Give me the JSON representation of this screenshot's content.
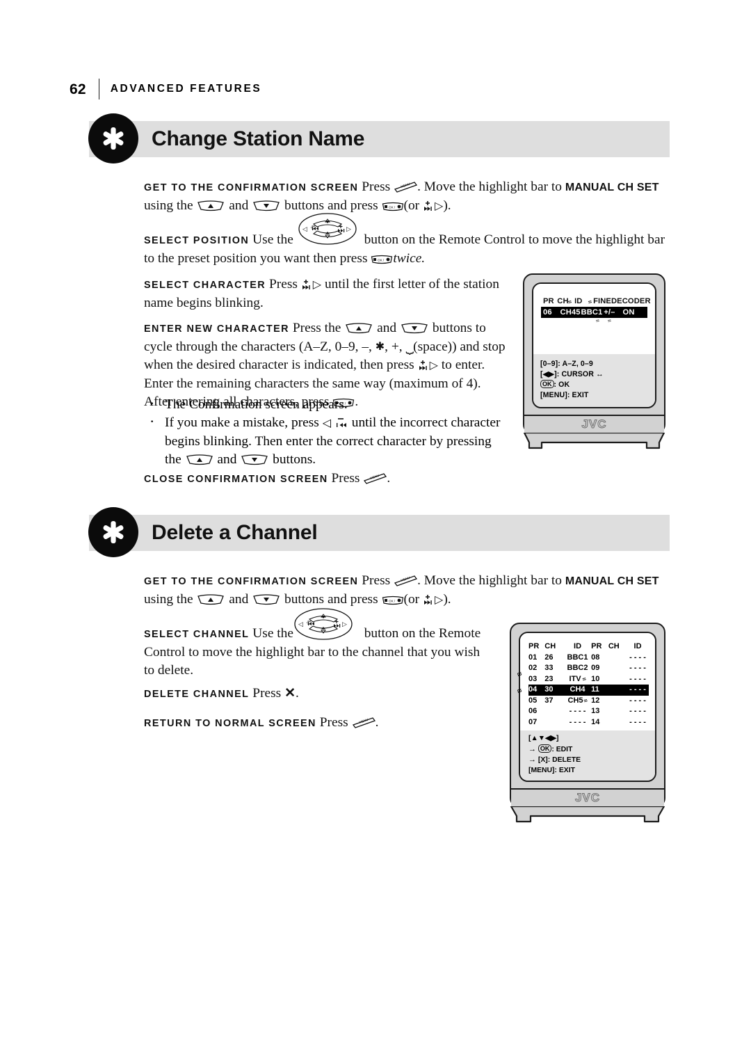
{
  "page": {
    "number": "62",
    "running_head": "ADVANCED FEATURES"
  },
  "sections": [
    {
      "id": "change-station-name",
      "title": "Change Station Name",
      "icon": "asterisk-star-icon",
      "steps": [
        {
          "label": "GET TO THE CONFIRMATION SCREEN",
          "text_1": "Press",
          "icon_1": "menu-button-icon",
          "text_2": ". Move the highlight bar to",
          "emphasis": "MANUAL CH SET",
          "text_3": "using the",
          "icon_2": "channel-up-button-icon",
          "text_4": "and",
          "icon_3": "channel-down-button-icon",
          "text_5": "buttons and press",
          "icon_4": "ok-button-icon",
          "text_6": "(or",
          "icon_5": "forward-plus-button-icon",
          "icon_6": "right-triangle-icon",
          "text_7": ")."
        },
        {
          "label": "SELECT POSITION",
          "text_1": "Use the",
          "icon_1": "four-way-pad-icon",
          "text_2": "button on the Remote Control to move the highlight bar to the preset position you want then press",
          "icon_2": "ok-button-icon",
          "text_3": "twice."
        },
        {
          "label": "SELECT CHARACTER",
          "text_1": "Press",
          "icon_1": "forward-plus-button-icon",
          "icon_2": "right-triangle-icon",
          "text_2": "until the first letter of the station name begins blinking."
        },
        {
          "label": "ENTER NEW CHARACTER",
          "text_1": "Press the",
          "icon_1": "channel-up-button-icon",
          "text_2": "and",
          "icon_2": "channel-down-button-icon",
          "text_3": "buttons to cycle through the characters (A–Z, 0–9, –,",
          "icon_3": "star-icon",
          "text_4": ", +,",
          "icon_4": "space-underscore-icon",
          "text_5": "(space)) and stop when the desired character is indicated, then press",
          "icon_5": "forward-plus-button-icon",
          "icon_6": "right-triangle-icon",
          "text_6": "to enter. Enter the remaining characters the same way (maximum of 4). After entering all characters, press",
          "icon_7": "ok-button-icon",
          "text_7": "."
        }
      ],
      "bullets": [
        {
          "text_1": "The Confirmation screen appears."
        },
        {
          "text_1": "If you make a mistake, press",
          "icon_1": "left-triangle-icon",
          "icon_2": "rewind-minus-button-icon",
          "text_2": "until the incorrect character begins blinking. Then enter the correct character by pressing the",
          "icon_3": "channel-up-button-icon",
          "text_3": "and",
          "icon_4": "channel-down-button-icon",
          "text_4": "buttons."
        }
      ],
      "closing": {
        "label": "CLOSE CONFIRMATION SCREEN",
        "text_1": "Press",
        "icon_1": "menu-button-icon",
        "text_2": "."
      }
    },
    {
      "id": "delete-a-channel",
      "title": "Delete a Channel",
      "icon": "asterisk-star-icon",
      "steps": [
        {
          "label": "GET TO THE CONFIRMATION SCREEN",
          "text_1": "Press",
          "icon_1": "menu-button-icon",
          "text_2": ". Move the highlight bar to",
          "emphasis": "MANUAL CH SET",
          "text_3": "using the",
          "icon_2": "channel-up-button-icon",
          "text_4": "and",
          "icon_3": "channel-down-button-icon",
          "text_5": "buttons and press",
          "icon_4": "ok-button-icon",
          "text_6": "(or",
          "icon_5": "forward-plus-button-icon",
          "icon_6": "right-triangle-icon",
          "text_7": ")."
        },
        {
          "label": "SELECT CHANNEL",
          "text_1": "Use the",
          "icon_1": "four-way-pad-icon",
          "text_2": "button on the Remote Control to move the highlight bar to the channel that you wish to delete."
        },
        {
          "label": "DELETE CHANNEL",
          "text_1": "Press",
          "icon_1": "x-cancel-icon",
          "text_2": "."
        },
        {
          "label": "RETURN TO NORMAL SCREEN",
          "text_1": "Press",
          "icon_1": "menu-button-icon",
          "text_2": "."
        }
      ]
    }
  ],
  "tv_screen_1": {
    "brand": "JVC",
    "table": {
      "headers": [
        "PR",
        "CH",
        "ID",
        "FINE",
        "DECODER"
      ],
      "rows": [
        {
          "PR": "06",
          "CH": "CH45",
          "ID": "BBC1",
          "FINE": "+/–",
          "DECODER": "ON",
          "highlighted": true
        }
      ]
    },
    "help": [
      {
        "key": "[0–9]:",
        "action": "A–Z, 0–9"
      },
      {
        "key": "[◀▶]:",
        "action": "CURSOR ↔"
      },
      {
        "key": "OK",
        "action": ": OK",
        "boxed": true
      },
      {
        "key": "[MENU]:",
        "action": "EXIT"
      }
    ]
  },
  "tv_screen_2": {
    "brand": "JVC",
    "table": {
      "headers": [
        "PR",
        "CH",
        "ID",
        "PR",
        "CH",
        "ID"
      ],
      "rows": [
        {
          "PR": "01",
          "CH": "26",
          "ID": "BBC1",
          "PR2": "08",
          "CH2": "",
          "ID2": "- - - -",
          "highlighted": false
        },
        {
          "PR": "02",
          "CH": "33",
          "ID": "BBC2",
          "PR2": "09",
          "CH2": "",
          "ID2": "- - - -",
          "highlighted": false
        },
        {
          "PR": "03",
          "CH": "23",
          "ID": "ITV",
          "PR2": "10",
          "CH2": "",
          "ID2": "- - - -",
          "highlighted": false,
          "blink": true
        },
        {
          "PR": "04",
          "CH": "30",
          "ID": "CH4",
          "PR2": "11",
          "CH2": "",
          "ID2": "- - - -",
          "highlighted": true
        },
        {
          "PR": "05",
          "CH": "37",
          "ID": "CH5",
          "PR2": "12",
          "CH2": "",
          "ID2": "- - - -",
          "highlighted": false,
          "blink": true
        },
        {
          "PR": "06",
          "CH": "",
          "ID": "- - - -",
          "PR2": "13",
          "CH2": "",
          "ID2": "- - - -",
          "highlighted": false
        },
        {
          "PR": "07",
          "CH": "",
          "ID": "- - - -",
          "PR2": "14",
          "CH2": "",
          "ID2": "- - - -",
          "highlighted": false
        }
      ]
    },
    "help": [
      {
        "key": "[▲▼◀▶]",
        "action": ""
      },
      {
        "key": "OK",
        "action": ": EDIT",
        "boxed": true,
        "arrow": true
      },
      {
        "key": "[X]",
        "action": ": DELETE",
        "boxed_x": true,
        "arrow": true
      },
      {
        "key": "[MENU]:",
        "action": "EXIT"
      }
    ]
  },
  "colors": {
    "banner_bg": "#dedede",
    "bullet_circle": "#0b0b0b",
    "tv_body": "#d2d2d2",
    "osd_help_bg": "#e3e3e3",
    "highlight": "#000000",
    "ink": "#111111"
  }
}
